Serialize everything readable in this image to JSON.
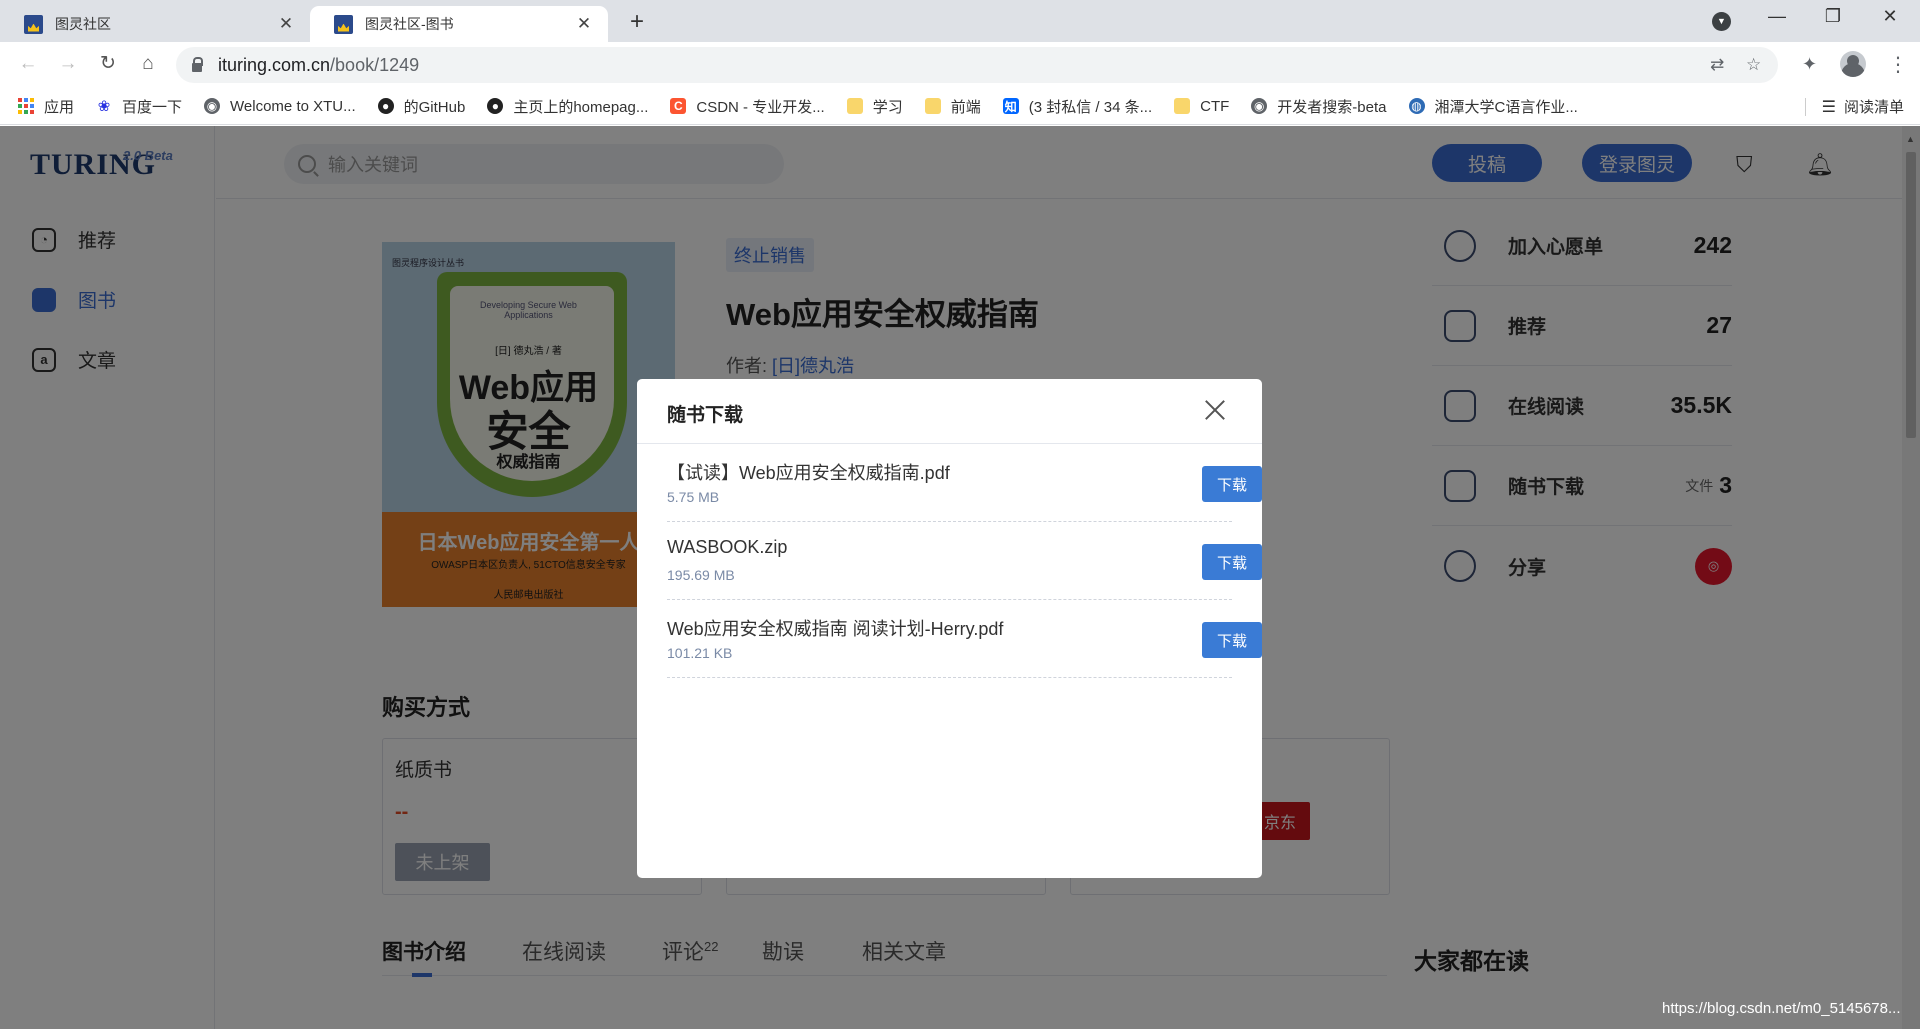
{
  "browser": {
    "tabs": [
      {
        "title": "图灵社区",
        "active": false
      },
      {
        "title": "图灵社区-图书",
        "active": true
      }
    ],
    "new_tab": "+",
    "url_host": "ituring.com.cn",
    "url_path": "/book/1249",
    "bookmarks": [
      "应用",
      "百度一下",
      "Welcome to XTU...",
      "的GitHub",
      "主页上的homepag...",
      "CSDN - 专业开发...",
      "学习",
      "前端",
      "(3 封私信 / 34 条...",
      "CTF",
      "开发者搜索-beta",
      "湘潭大学C语言作业..."
    ],
    "reading_list": "阅读清单"
  },
  "site": {
    "logo": "TURING",
    "logo_beta": "2.0 Beta",
    "nav": [
      {
        "label": "推荐",
        "active": false,
        "icon": "discover-icon"
      },
      {
        "label": "图书",
        "active": true,
        "icon": "book-icon"
      },
      {
        "label": "文章",
        "active": false,
        "icon": "article-icon"
      }
    ],
    "search_placeholder": "输入关键词",
    "submit_btn": "投稿",
    "login_btn": "登录图灵"
  },
  "book": {
    "status": "终止销售",
    "title": "Web应用安全权威指南",
    "author_label": "作者:",
    "author": "[日]德丸浩",
    "cover": {
      "series": "图灵程序设计丛书",
      "en": "Developing Secure Web Applications",
      "author": "[日] 德丸浩 / 著",
      "t1": "Web应用",
      "t2": "安全",
      "t3": "权威指南",
      "band": "日本Web应用安全第一人",
      "band_sub": "OWASP日本区负责人, 51CTO信息安全专家",
      "publisher": "人民邮电出版社"
    }
  },
  "stats": [
    {
      "label": "加入心愿单",
      "value": "242"
    },
    {
      "label": "推荐",
      "value": "27"
    },
    {
      "label": "在线阅读",
      "value": "35.5K"
    },
    {
      "label": "随书下载",
      "prefix": "文件",
      "value": "3"
    },
    {
      "label": "分享"
    }
  ],
  "buy": {
    "title": "购买方式",
    "paper": "纸质书",
    "price_dash": "--",
    "unavailable": "未上架",
    "jd": "京东"
  },
  "page_tabs": [
    {
      "label": "图书介绍",
      "active": true
    },
    {
      "label": "在线阅读"
    },
    {
      "label": "评论",
      "sup": "22"
    },
    {
      "label": "勘误"
    },
    {
      "label": "相关文章"
    }
  ],
  "sidebar_reading": "大家都在读",
  "dialog": {
    "title": "随书下载",
    "download_label": "下载",
    "files": [
      {
        "name": "【试读】Web应用安全权威指南.pdf",
        "size": "5.75 MB"
      },
      {
        "name": "WASBOOK.zip",
        "size": "195.69 MB"
      },
      {
        "name": "Web应用安全权威指南 阅读计划-Herry.pdf",
        "size": "101.21 KB"
      }
    ]
  },
  "watermark": "https://blog.csdn.net/m0_5145678..."
}
